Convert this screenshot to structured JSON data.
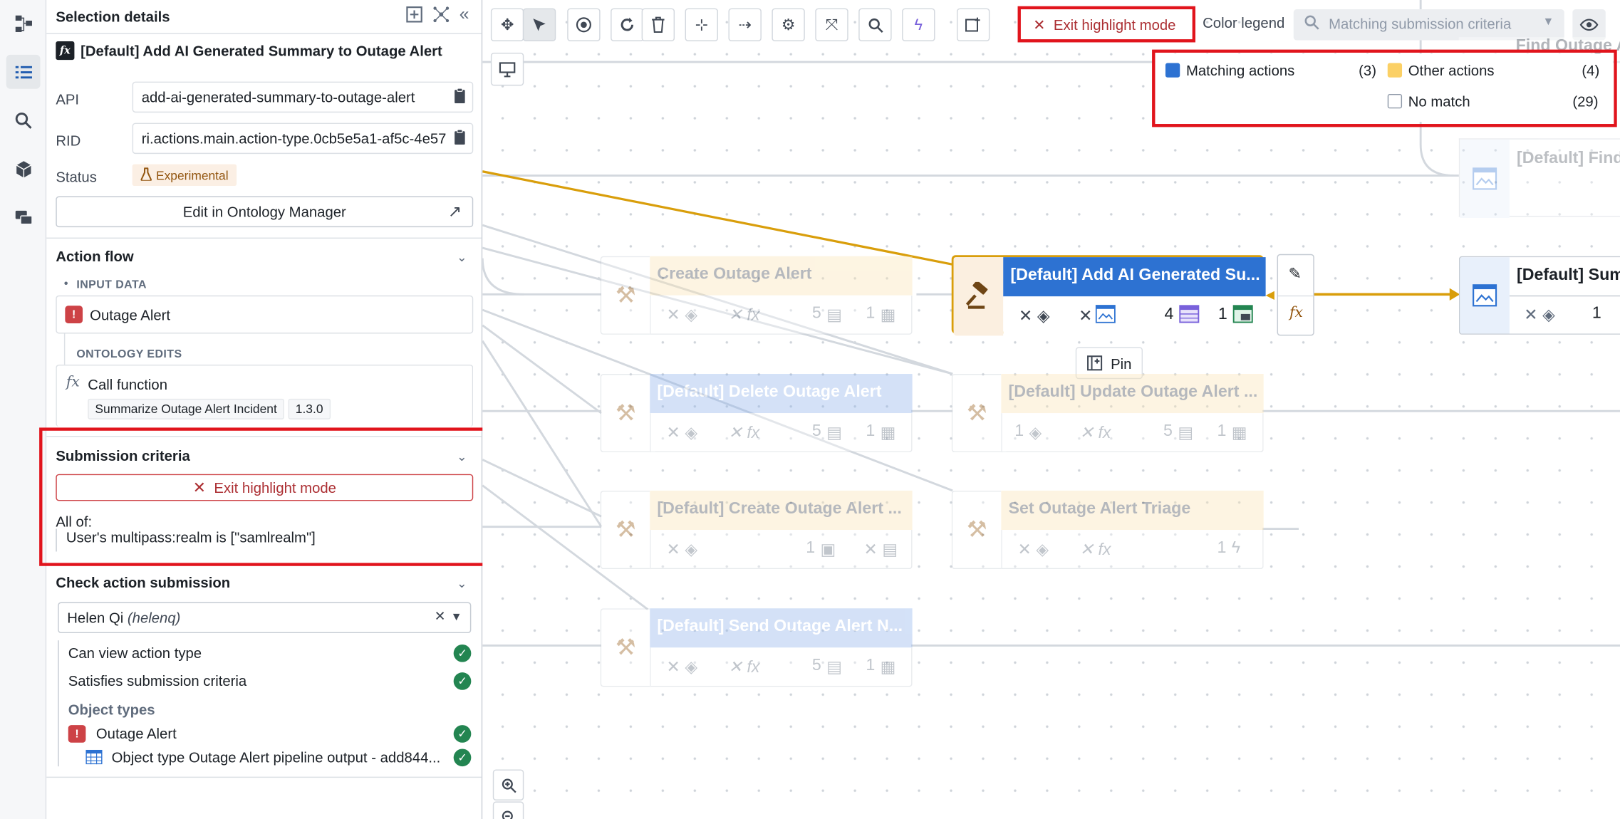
{
  "panel": {
    "title": "Selection details",
    "action_name": "[Default] Add AI Generated Summary to Outage Alert",
    "api_label": "API",
    "api_value": "add-ai-generated-summary-to-outage-alert",
    "rid_label": "RID",
    "rid_value": "ri.actions.main.action-type.0cb5e5a1-af5c-4e57",
    "status_label": "Status",
    "status_value": "Experimental",
    "edit_button": "Edit in Ontology Manager"
  },
  "action_flow": {
    "title": "Action flow",
    "input_data_label": "INPUT DATA",
    "input_item": "Outage Alert",
    "ontology_edits_label": "ONTOLOGY EDITS",
    "call_function": "Call function",
    "function_name": "Summarize Outage Alert Incident",
    "function_version": "1.3.0"
  },
  "submission_criteria": {
    "title": "Submission criteria",
    "exit_button": "Exit highlight mode",
    "all_of": "All of:",
    "criterion": "User's multipass:realm is [\"samlrealm\"]"
  },
  "check_submission": {
    "title": "Check action submission",
    "user_name": "Helen Qi",
    "user_handle": "(helenq)",
    "checks": [
      "Can view action type",
      "Satisfies submission criteria"
    ],
    "object_types_label": "Object types",
    "object_items": [
      "Outage Alert",
      "Object type Outage Alert pipeline output - add844..."
    ]
  },
  "toolbar": {
    "exit_highlight": "Exit highlight mode",
    "color_legend": "Color legend",
    "search_placeholder": "Matching submission criteria"
  },
  "legend": {
    "matching_label": "Matching actions",
    "matching_count": "(3)",
    "other_label": "Other actions",
    "other_count": "(4)",
    "nomatch_label": "No match",
    "nomatch_count": "(29)",
    "colors": {
      "matching": "#2d72d2",
      "other": "#fbd065",
      "nomatch": "#ffffff"
    }
  },
  "graph": {
    "pin_label": "Pin",
    "top_right_partial_1": "Find Outage A",
    "top_right_partial_2": "[Default] Find",
    "nodes": [
      {
        "title": "Create Outage Alert",
        "c1": "5",
        "c2": "1"
      },
      {
        "title": "[Default] Add AI Generated Su...",
        "c1": "4",
        "c2": "1"
      },
      {
        "title": "[Default] Sum",
        "c1": "1"
      },
      {
        "title": "[Default] Delete Outage Alert",
        "c1": "5",
        "c2": "1"
      },
      {
        "title": "[Default] Update Outage Alert ...",
        "c0": "1",
        "c1": "5",
        "c2": "1"
      },
      {
        "title": "[Default] Create Outage Alert ...",
        "c1": "1"
      },
      {
        "title": "Set Outage Alert Triage",
        "c1": "1"
      },
      {
        "title": "[Default] Send Outage Alert N...",
        "c1": "5",
        "c2": "1"
      }
    ]
  }
}
